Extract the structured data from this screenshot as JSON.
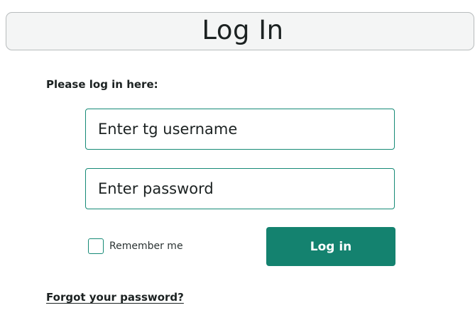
{
  "header": {
    "title": "Log In"
  },
  "form": {
    "prompt": "Please log in here:",
    "username_placeholder": "Enter tg username",
    "password_placeholder": "Enter password",
    "remember_label": "Remember me",
    "remember_checked": false,
    "submit_label": "Log in",
    "forgot_label": "Forgot your password?"
  },
  "colors": {
    "accent": "#14826f",
    "header_background": "#f4f5f5",
    "text": "#1c2222"
  }
}
